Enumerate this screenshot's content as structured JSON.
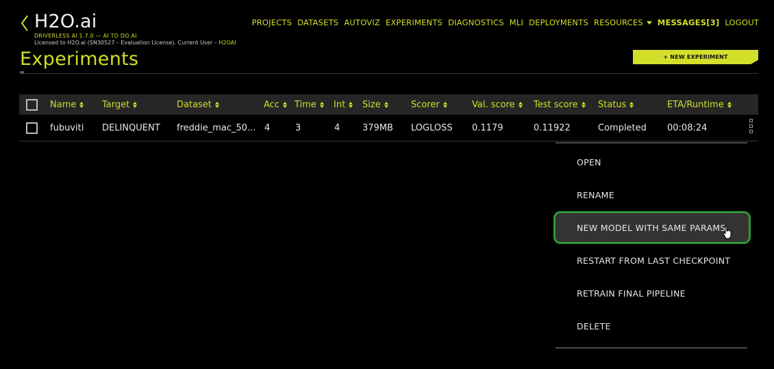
{
  "brand": {
    "title": "H2O.ai",
    "subtitle": "DRIVERLESS AI 1.7.0 — AI TO DO AI",
    "license_text": "Licensed to H2O.ai (SN30527 – Evaluation License). Current User – ",
    "current_user": "H2OAI"
  },
  "nav": {
    "projects": "PROJECTS",
    "datasets": "DATASETS",
    "autoviz": "AUTOVIZ",
    "experiments": "EXPERIMENTS",
    "diagnostics": "DIAGNOSTICS",
    "mli": "MLI",
    "deployments": "DEPLOYMENTS",
    "resources": "RESOURCES",
    "messages": "MESSAGES[3]",
    "logout": "LOGOUT"
  },
  "page": {
    "title": "Experiments",
    "new_button": "+ NEW EXPERIMENT"
  },
  "table": {
    "headers": {
      "name": "Name",
      "target": "Target",
      "dataset": "Dataset",
      "acc": "Acc",
      "time": "Time",
      "int": "Int",
      "size": "Size",
      "scorer": "Scorer",
      "val_score": "Val. score",
      "test_score": "Test score",
      "status": "Status",
      "eta": "ETA/Runtime"
    },
    "rows": [
      {
        "name": "fubuviti",
        "target": "DELINQUENT",
        "dataset": "freddie_mac_50...",
        "acc": "4",
        "time": "3",
        "int": "4",
        "size": "379MB",
        "scorer": "LOGLOSS",
        "val_score": "0.1179",
        "test_score": "0.11922",
        "status": "Completed",
        "eta": "00:08:24"
      }
    ]
  },
  "menu": {
    "items": [
      "OPEN",
      "RENAME",
      "NEW MODEL WITH SAME PARAMS",
      "RESTART FROM LAST CHECKPOINT",
      "RETRAIN FINAL PIPELINE",
      "DELETE"
    ],
    "highlighted": "NEW MODEL WITH SAME PARAMS"
  },
  "colors": {
    "accent": "#d3df2a",
    "background": "#000000",
    "header_row": "#262626",
    "highlight_border": "#2f9a35",
    "highlight_fill": "#333333"
  }
}
